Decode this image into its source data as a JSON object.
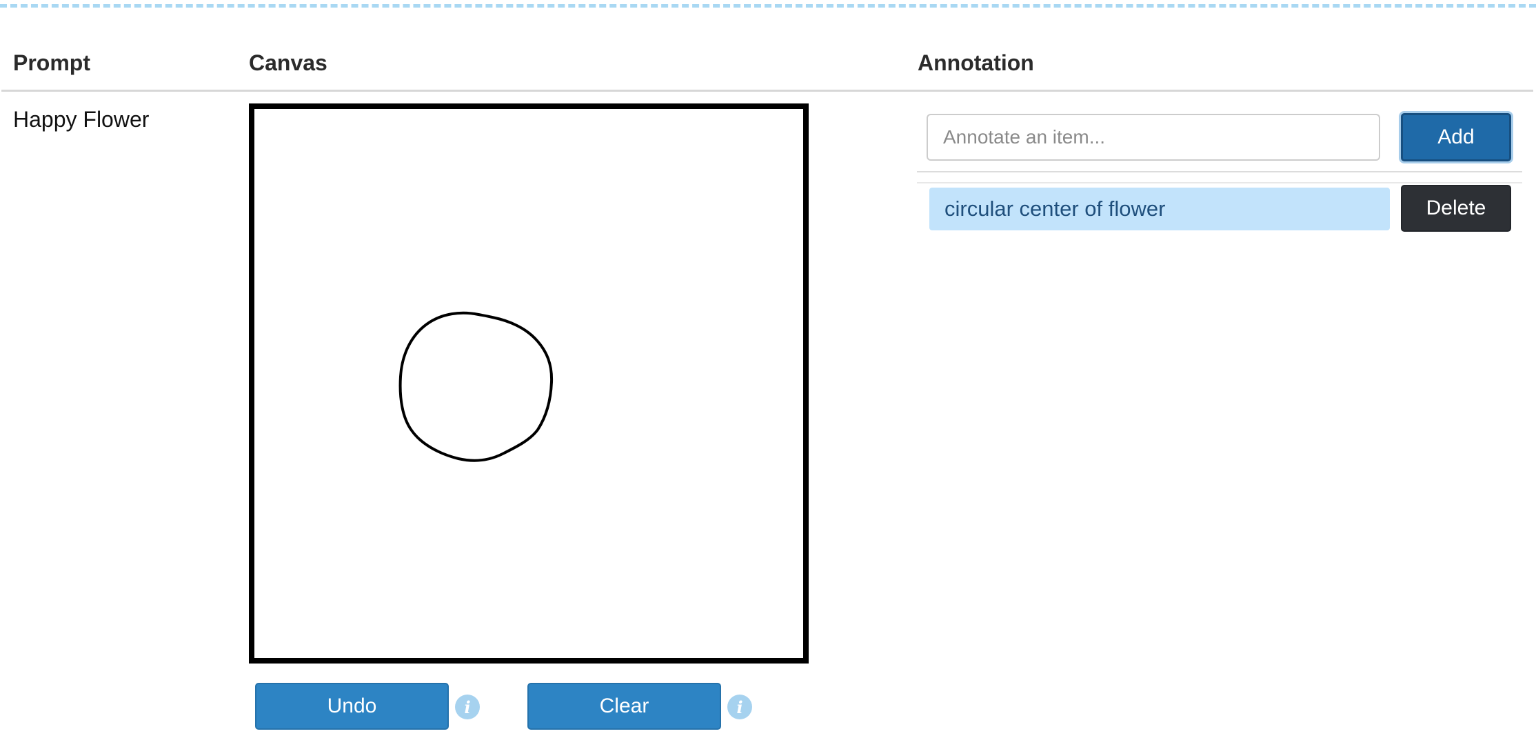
{
  "table": {
    "headers": {
      "prompt": "Prompt",
      "canvas": "Canvas",
      "annotation": "Annotation"
    }
  },
  "row": {
    "prompt": "Happy Flower"
  },
  "canvas_controls": {
    "undo_label": "Undo",
    "clear_label": "Clear",
    "info_icon_glyph": "i"
  },
  "annotation": {
    "input_value": "",
    "input_placeholder": "Annotate an item...",
    "add_label": "Add",
    "items": [
      {
        "label": "circular center of flower",
        "delete_label": "Delete"
      }
    ]
  },
  "colors": {
    "primary_button": "#2d84c4",
    "add_button": "#1f6aa8",
    "delete_button": "#2d3035",
    "annotation_highlight": "#c2e3fb",
    "info_icon": "#a6d2ef",
    "dashed_border": "#a9d8f3"
  },
  "icons": {
    "info": "info-icon"
  }
}
